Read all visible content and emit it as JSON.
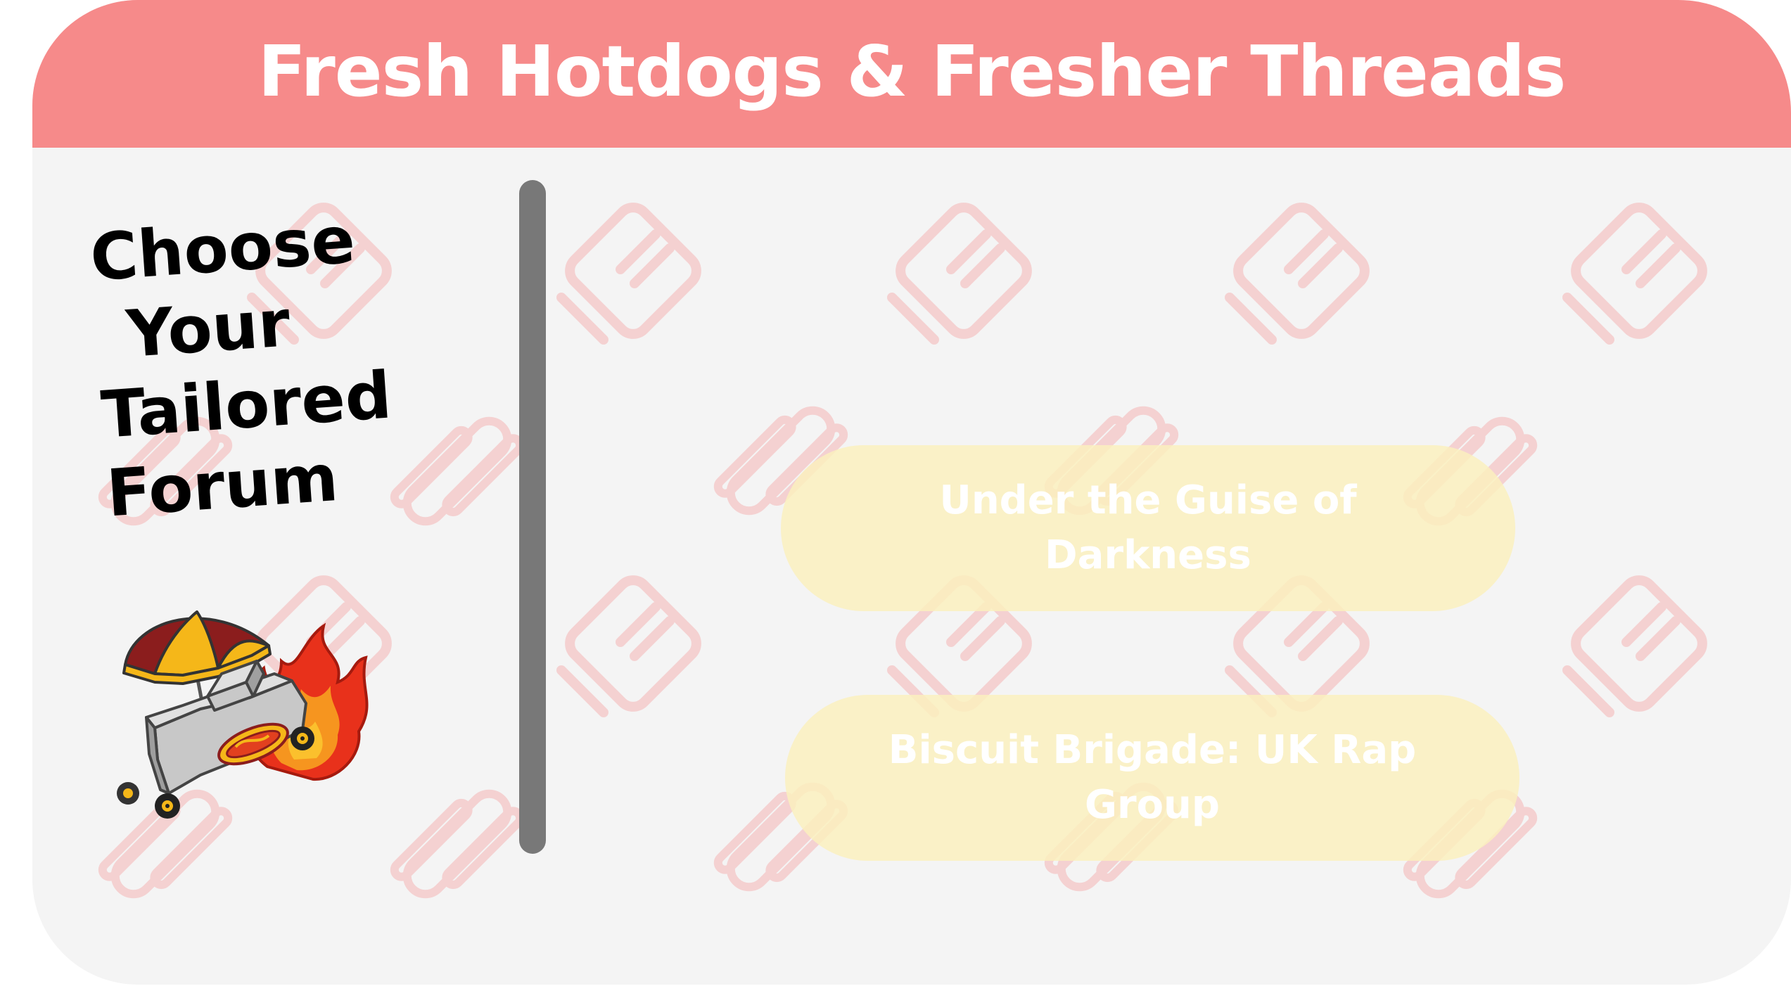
{
  "header": {
    "title": "Fresh Hotdogs & Fresher Threads"
  },
  "sidebar": {
    "heading_lines": [
      "Choose",
      "Your",
      "Tailored",
      "Forum"
    ],
    "illustration": "hotdog-cart-illustration"
  },
  "forums": [
    {
      "label": "Under the Guise of Darkness"
    },
    {
      "label": "Biscuit Brigade: UK Rap Group"
    }
  ],
  "icons": {
    "pattern_primary": "notepad-icon",
    "pattern_secondary": "hotdog-icon"
  },
  "colors": {
    "header_bg": "#f68a8a",
    "panel_bg": "#f4f4f4",
    "divider": "#787878",
    "button_bg": "#faf0be",
    "pattern": "#f7d0d0"
  }
}
